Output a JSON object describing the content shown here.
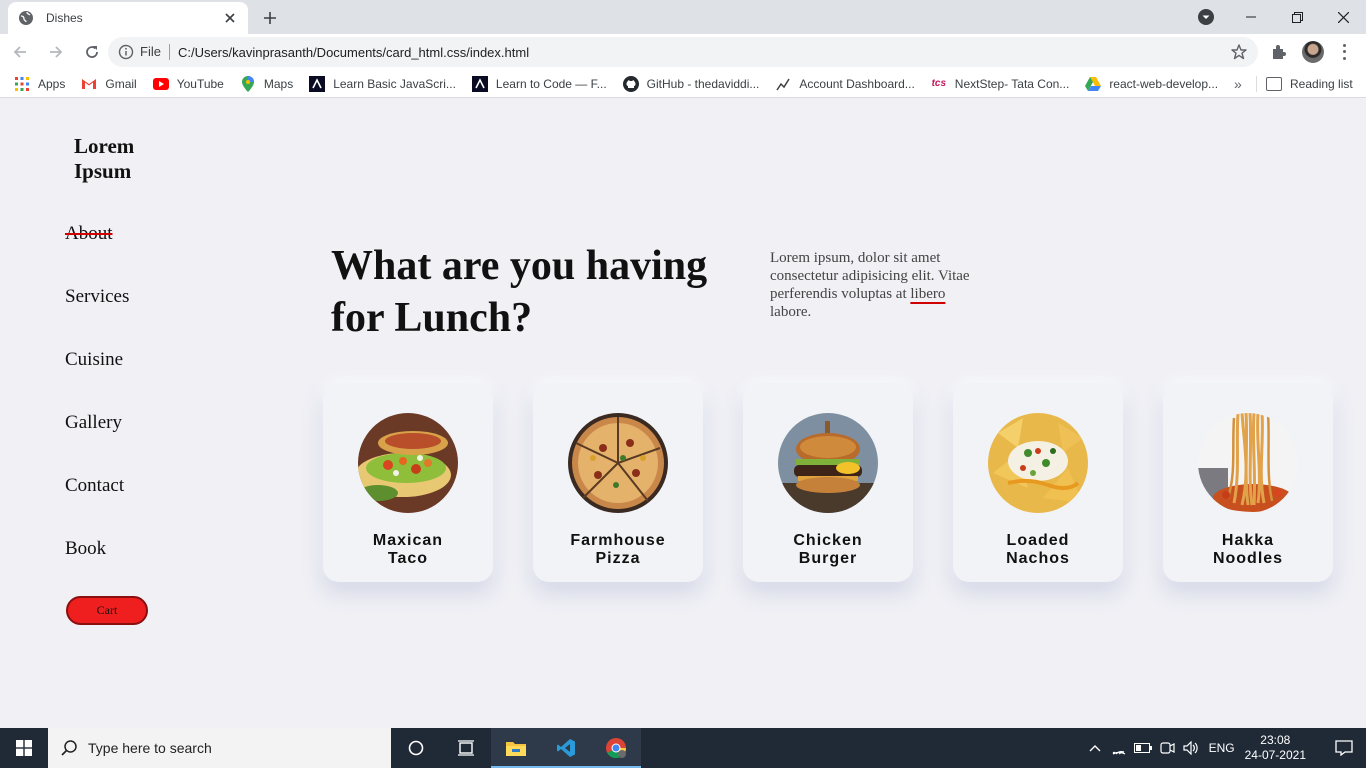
{
  "browser": {
    "tab_title": "Dishes",
    "file_label": "File",
    "url": "C:/Users/kavinprasanth/Documents/card_html.css/index.html",
    "bookmarks": [
      {
        "label": "Apps",
        "icon": "apps-grid-icon"
      },
      {
        "label": "Gmail",
        "icon": "gmail-icon"
      },
      {
        "label": "YouTube",
        "icon": "youtube-icon"
      },
      {
        "label": "Maps",
        "icon": "maps-pin-icon"
      },
      {
        "label": "Learn Basic JavaScri...",
        "icon": "freecodecamp-icon"
      },
      {
        "label": "Learn to Code — F...",
        "icon": "freecodecamp-icon"
      },
      {
        "label": "GitHub - thedaviddi...",
        "icon": "github-icon"
      },
      {
        "label": "Account Dashboard...",
        "icon": "elm-icon"
      },
      {
        "label": "NextStep- Tata Con...",
        "icon": "tcs-icon"
      },
      {
        "label": "react-web-develop...",
        "icon": "google-drive-icon"
      }
    ],
    "reading_list": "Reading list"
  },
  "site": {
    "logo": "Lorem Ipsum",
    "nav": [
      "About",
      "Services",
      "Cuisine",
      "Gallery",
      "Contact",
      "Book"
    ],
    "cart_label": "Cart",
    "headline": "What are you having for Lunch?",
    "blurb_text": "Lorem ipsum, dolor sit amet consectetur adipisicing elit. Vitae perferendis voluptas at",
    "blurb_underlined": "libero",
    "blurb_end": "labore.",
    "cards": [
      {
        "title": "Maxican\nTaco",
        "image": "taco"
      },
      {
        "title": "Farmhouse\nPizza",
        "image": "pizza"
      },
      {
        "title": "Chicken\nBurger",
        "image": "burger"
      },
      {
        "title": "Loaded\nNachos",
        "image": "nachos"
      },
      {
        "title": "Hakka\nNoodles",
        "image": "noodles"
      }
    ]
  },
  "taskbar": {
    "search_placeholder": "Type here to search",
    "language": "ENG",
    "time": "23:08",
    "date": "24-07-2021"
  },
  "colors": {
    "accent_red": "#f01f1f",
    "page_bg": "#f0f0f5"
  }
}
